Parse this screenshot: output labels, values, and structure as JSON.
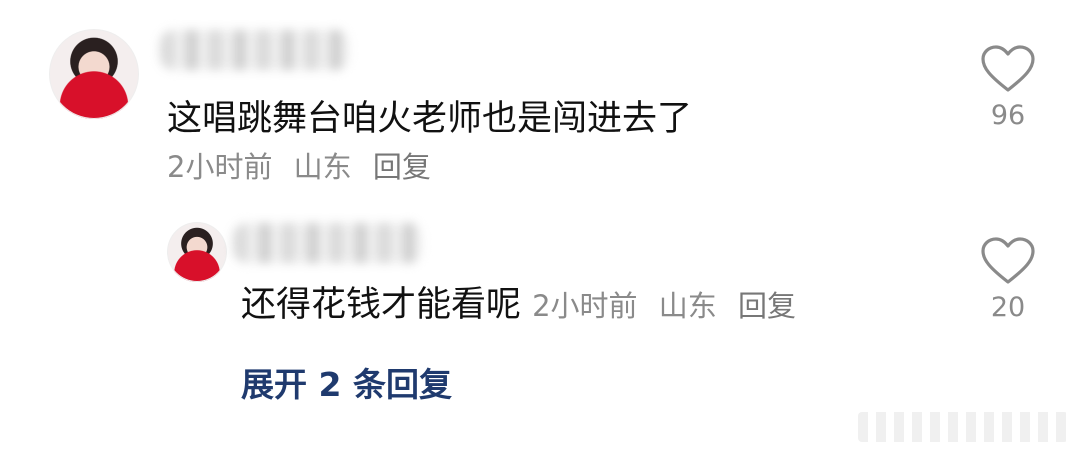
{
  "comment": {
    "text": "这唱跳舞台咱火老师也是闯进去了",
    "time": "2小时前",
    "location": "山东",
    "reply_label": "回复",
    "like_count": "96"
  },
  "reply": {
    "text": "还得花钱才能看呢",
    "time": "2小时前",
    "location": "山东",
    "reply_label": "回复",
    "like_count": "20"
  },
  "expand_label": "展开 2 条回复",
  "icons": {
    "like": "heart-outline-icon"
  },
  "colors": {
    "text": "#111111",
    "meta": "#8a8a8a",
    "link": "#1f3a6e"
  }
}
